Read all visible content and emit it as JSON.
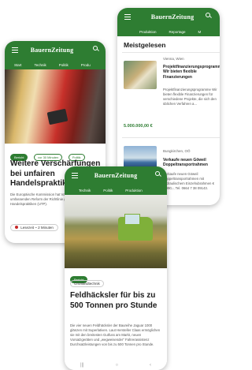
{
  "brand": "BauernZeitung",
  "colors": {
    "accent": "#2e7d32"
  },
  "phone_right": {
    "tabs": [
      "Produktion",
      "Reportage",
      "M"
    ],
    "section_title": "Meistgelesen",
    "listing1": {
      "location": "Vienna, Wien",
      "title": "Projektfinanzierungsprogramme Wir bieten flexible Finanzierungen",
      "desc": "Projektfinanzierungsprogramme Wir bieten flexible Finanzierungen für verschiedene Projekte, die sich den üblichen Verfahren a...",
      "price": "5.000.000,00 €"
    },
    "listing2": {
      "location": "Bungkirchen, OÖ",
      "title": "Verkaufe neuen Göweil Doppeltransportrahmen",
      "desc": "Verkaufe neuen Göweil Doppeltransportrahmen mit hydraulischem Einzehubrahmen € 2.990,-, Tel. 0664 7 38 09143."
    }
  },
  "phone_left": {
    "tabs": [
      "Start",
      "Technik",
      "Politik",
      "Produ"
    ],
    "tags": {
      "category": "Bericht",
      "reading": "vor 30 Minuten",
      "section": "Politik"
    },
    "headline": "Weitere Verschärfungen bei unfairen Handelspraktiken",
    "teaser": "Die Europäische Kommission hat Vorschläge für einen umfassenden Reform der Richtlinie gegen unfaire Handelspraktiken (UTP).",
    "read_time": "Lesezeit ~ 2 Minuten"
  },
  "phone_front": {
    "tabs": [
      "Technik",
      "Politik",
      "Produktion"
    ],
    "tags": {
      "category": "Bericht",
      "section": "Grünlandtechnik"
    },
    "headline": "Feldhäcksler für bis zu 500 Tonnen pro Stunde",
    "teaser": "Die vier neuen Feldhäcksler der Baureihe Jaguar 1000 glänzen mit Superlativen. Laut Hersteller Claas ermöglichen sie mit den breitesten Gutfuss am Markt, neuen Vorsatzgeräten und „wegweisender“ Fahrerassistenz Durchsatzleistungen von bis zu 500 Tonnen pro Stunde."
  },
  "nav": {
    "recent": "|||",
    "home": "○",
    "back": "‹"
  }
}
